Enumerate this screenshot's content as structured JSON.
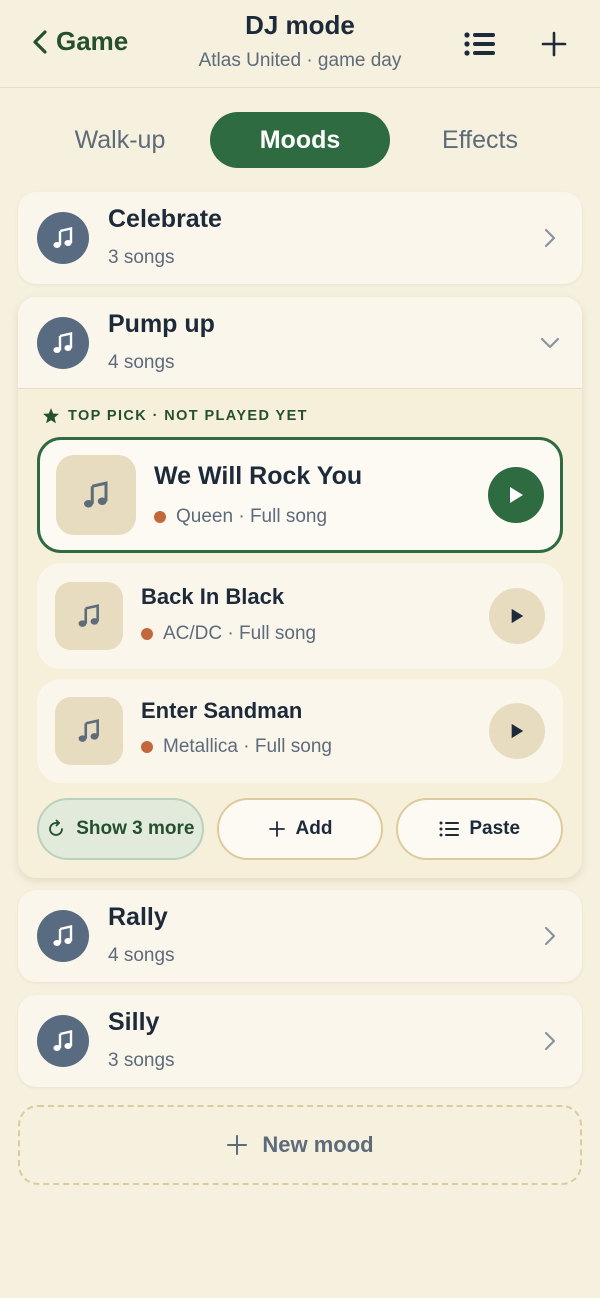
{
  "header": {
    "back_label": "Game",
    "title": "DJ mode",
    "subtitle": "Atlas United · game day",
    "list_icon": "list-icon",
    "add_icon": "plus-icon"
  },
  "tabs": [
    {
      "label": "Walk-up",
      "active": false
    },
    {
      "label": "Moods",
      "active": true
    },
    {
      "label": "Effects",
      "active": false
    }
  ],
  "moods": [
    {
      "name": "Celebrate",
      "count": "3 songs",
      "expanded": false
    },
    {
      "name": "Pump up",
      "count": "4 songs",
      "expanded": true,
      "top_pick_label": "TOP PICK · NOT PLAYED YET",
      "songs": [
        {
          "title": "We Will Rock You",
          "artist": "Queen",
          "type": "Full song",
          "top_pick": true
        },
        {
          "title": "Back In Black",
          "artist": "AC/DC",
          "type": "Full song",
          "top_pick": false
        },
        {
          "title": "Enter Sandman",
          "artist": "Metallica",
          "type": "Full song",
          "top_pick": false
        }
      ],
      "actions": {
        "show_more": "Show 3 more",
        "add": "Add",
        "paste": "Paste"
      }
    },
    {
      "name": "Rally",
      "count": "4 songs",
      "expanded": false
    },
    {
      "name": "Silly",
      "count": "3 songs",
      "expanded": false
    }
  ],
  "new_mood_label": "New mood",
  "colors": {
    "background": "#f6f0de",
    "accent": "#2e6b40",
    "avatar": "#596b80",
    "artist_dot": "#c3683c"
  }
}
